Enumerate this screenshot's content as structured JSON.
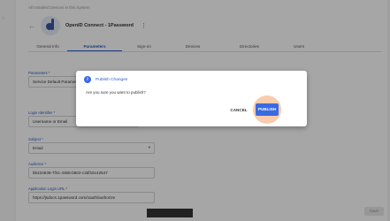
{
  "breadcrumb": "All Installed Devices in this System",
  "app": {
    "title": "OpenID Connect - 1Password",
    "kebab": "⋮"
  },
  "tabs": [
    "General Info",
    "Parameters",
    "Sign-on",
    "Devices",
    "Directories",
    "Users"
  ],
  "active_tab": "Parameters",
  "fields": {
    "parameters": {
      "label": "Parameters *",
      "value": "Service Default Paramet"
    },
    "login_identifier": {
      "label": "Login Identifier *",
      "value": "Username or Email"
    },
    "subject": {
      "label": "Subject *",
      "value": "Email"
    },
    "audience": {
      "label": "Audience *",
      "value": "bb434639-7f41-4365-b502-c3df15c42547"
    },
    "app_login_url": {
      "label": "Application Login URL *",
      "value": "https://jsdocs.1password.com/oauth/authorize"
    }
  },
  "save_label": "SAVE",
  "dialog": {
    "info_icon": "i",
    "title": "Publish Changes",
    "message": "Are you sure you want to publish?",
    "cancel_label": "CANCEL",
    "publish_label": "PUBLISH"
  },
  "colors": {
    "accent": "#2a5cc7",
    "button": "#3a6ae0",
    "highlight": "#f6aa78"
  }
}
